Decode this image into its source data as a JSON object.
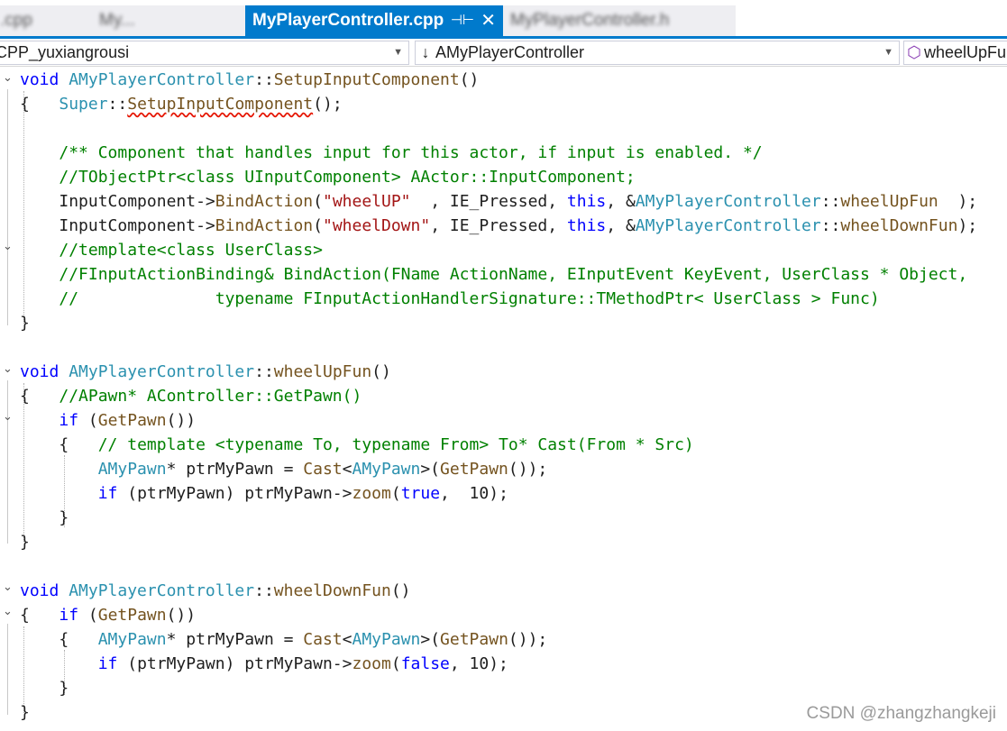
{
  "tabs": [
    {
      "label": ".cpp",
      "state": "inactive"
    },
    {
      "label": "My...",
      "state": "inactive"
    },
    {
      "label": "MyPlayerController.cpp",
      "state": "active",
      "pin_icon": "pin-icon",
      "close_icon": "close-icon"
    },
    {
      "label": "MyPlayerController.h",
      "state": "inactive"
    }
  ],
  "navbar": {
    "project": "CPP_yuxiangrousi",
    "scope": "AMyPlayerController",
    "member": "wheelUpFun"
  },
  "code": {
    "l1": {
      "kw": "void",
      "cls": "AMyPlayerController",
      "sep": "::",
      "fn": "SetupInputComponent",
      "tail": "()"
    },
    "l2": {
      "brace": "{",
      "cls": "Super",
      "sep": "::",
      "fn": "SetupInputComponent",
      "tail": "();"
    },
    "l4": "/** Component that handles input for this actor, if input is enabled. */",
    "l5": "//TObjectPtr<class UInputComponent> AActor::InputComponent;",
    "l6": {
      "a": "InputComponent",
      "b": "->",
      "c": "BindAction",
      "d": "(",
      "e": "\"wheelUP\"",
      "f": "  , IE_Pressed, ",
      "g": "this",
      "h": ", &",
      "i": "AMyPlayerController",
      "j": "::",
      "k": "wheelUpFun",
      "l": "  );"
    },
    "l7": {
      "a": "InputComponent",
      "b": "->",
      "c": "BindAction",
      "d": "(",
      "e": "\"wheelDown\"",
      "f": ", IE_Pressed, ",
      "g": "this",
      "h": ", &",
      "i": "AMyPlayerController",
      "j": "::",
      "k": "wheelDownFun",
      "l": ");"
    },
    "l8": "//template<class UserClass>",
    "l9": "//FInputActionBinding& BindAction(FName ActionName, EInputEvent KeyEvent, UserClass * Object,",
    "l10": "//              typename FInputActionHandlerSignature::TMethodPtr< UserClass > Func)",
    "l11": "}",
    "l13": {
      "kw": "void",
      "cls": "AMyPlayerController",
      "sep": "::",
      "fn": "wheelUpFun",
      "tail": "()"
    },
    "l14": {
      "brace": "{",
      "cm": "//APawn* AController::GetPawn()"
    },
    "l15": {
      "kw": "if",
      "a": " (",
      "fn": "GetPawn",
      "b": "())"
    },
    "l16": {
      "brace": "{",
      "cm": "// template <typename To, typename From> To* Cast(From * Src)"
    },
    "l17": {
      "cls": "AMyPawn",
      "a": "* ptrMyPawn = ",
      "fn": "Cast",
      "b": "<",
      "cls2": "AMyPawn",
      "c": ">(",
      "fn2": "GetPawn",
      "d": "());"
    },
    "l18": {
      "kw": "if",
      "a": " (ptrMyPawn) ptrMyPawn->",
      "fn": "zoom",
      "b": "(",
      "kw2": "true",
      "c": ",  10);"
    },
    "l19": "}",
    "l20": "}",
    "l22": {
      "kw": "void",
      "cls": "AMyPlayerController",
      "sep": "::",
      "fn": "wheelDownFun",
      "tail": "()"
    },
    "l23": {
      "brace": "{",
      "kw": "if",
      "a": " (",
      "fn": "GetPawn",
      "b": "())"
    },
    "l24": {
      "brace": "{",
      "cls": "AMyPawn",
      "a": "* ptrMyPawn = ",
      "fn": "Cast",
      "b": "<",
      "cls2": "AMyPawn",
      "c": ">(",
      "fn2": "GetPawn",
      "d": "());"
    },
    "l25": {
      "kw": "if",
      "a": " (ptrMyPawn) ptrMyPawn->",
      "fn": "zoom",
      "b": "(",
      "kw2": "false",
      "c": ", 10);"
    },
    "l26": "}",
    "l27": "}"
  },
  "watermark": "CSDN @zhangzhangkeji",
  "colors": {
    "accent": "#007acc",
    "keyword": "#0000ff",
    "type": "#2b91af",
    "function": "#74531f",
    "comment": "#008000",
    "string": "#a31515"
  }
}
